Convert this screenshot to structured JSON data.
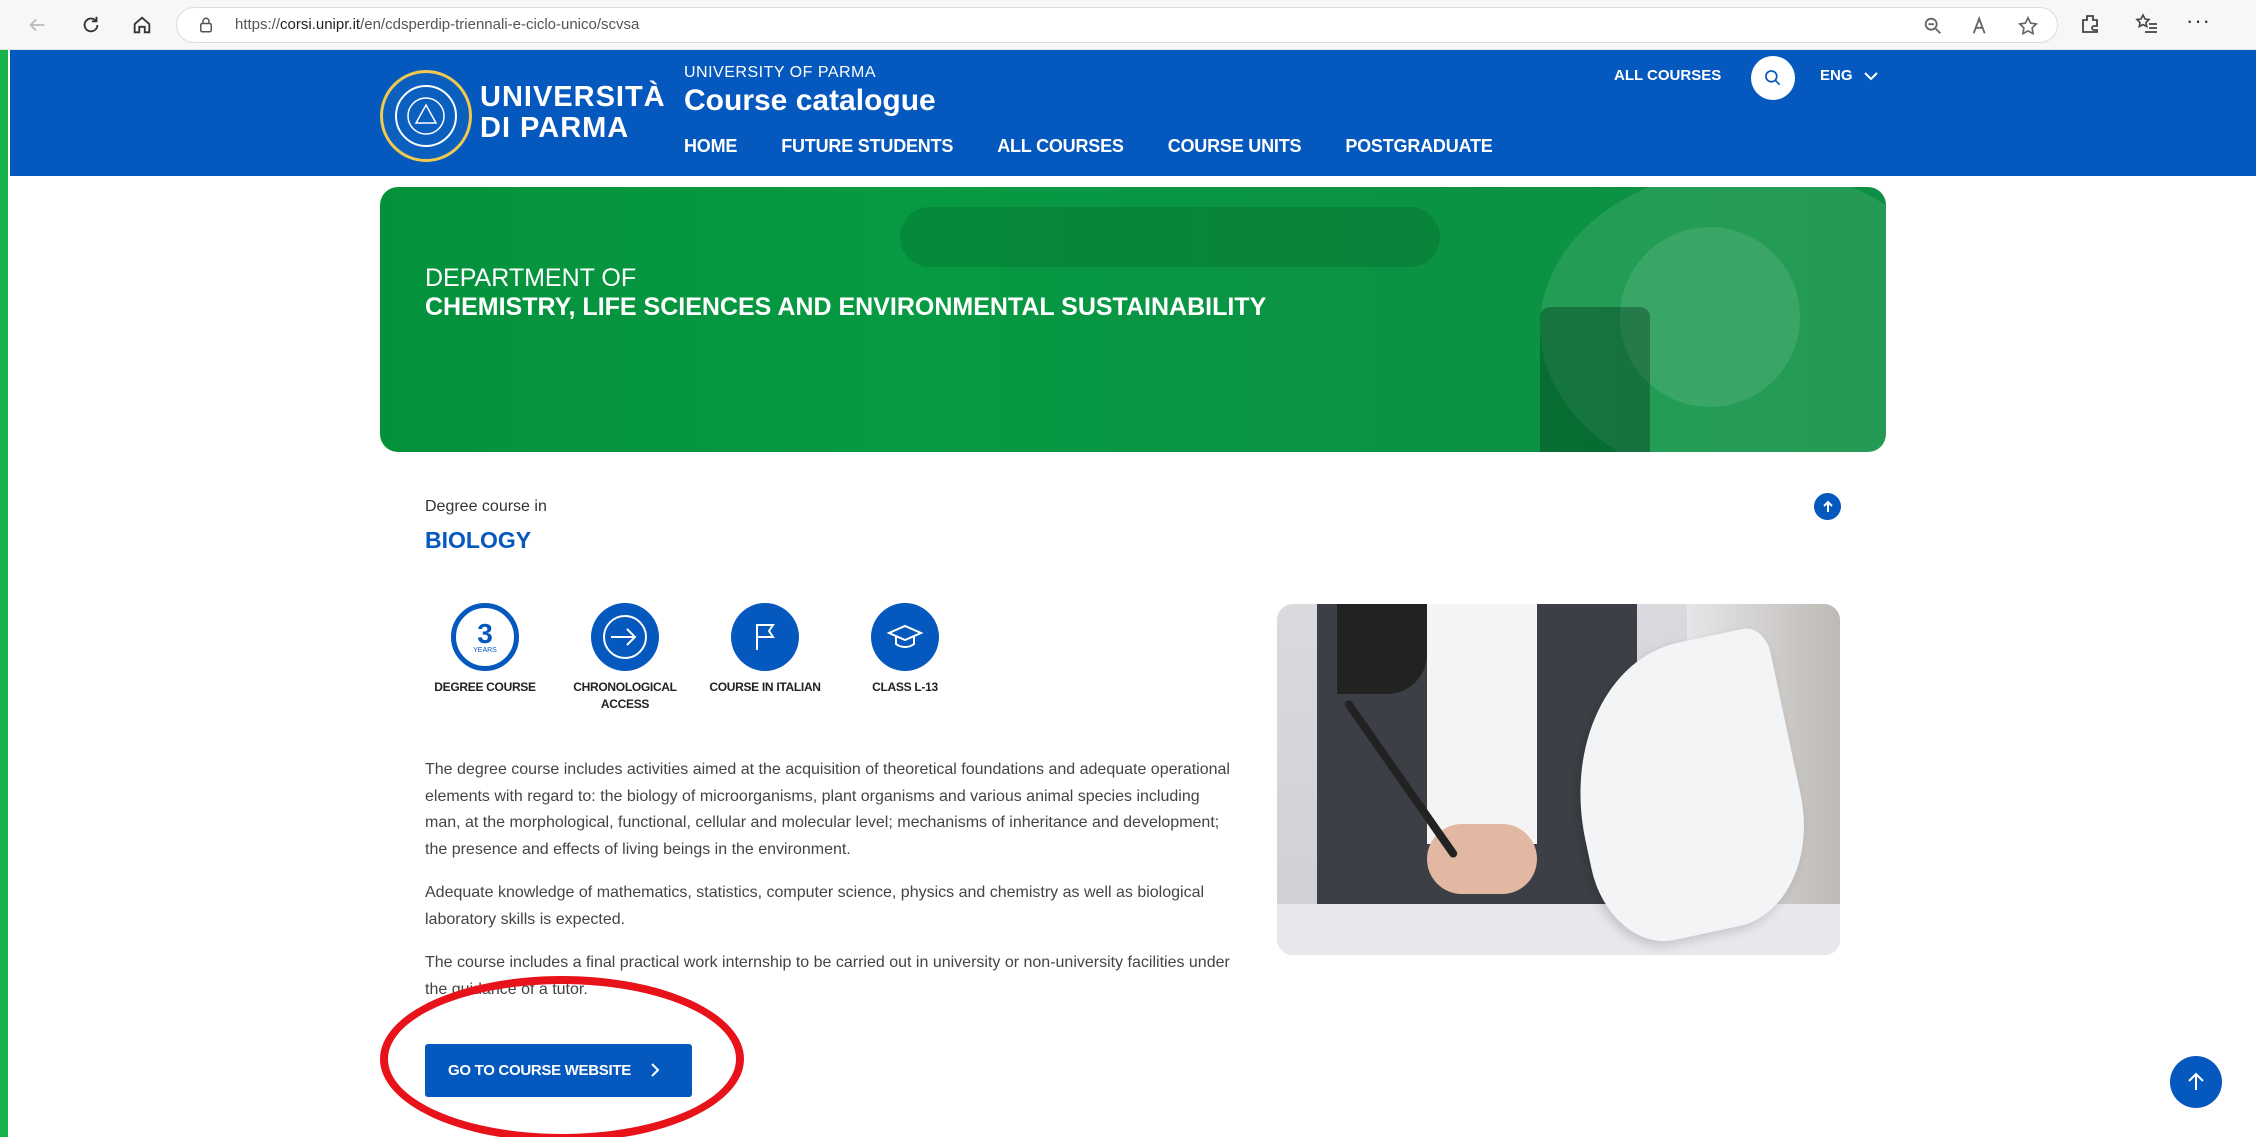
{
  "browser": {
    "url_prefix": "https://",
    "url_domain": "corsi.unipr.it",
    "url_path": "/en/cdsperdip-triennali-e-ciclo-unico/scvsa"
  },
  "header": {
    "logo_line1": "UNIVERSITÀ",
    "logo_line2": "DI PARMA",
    "overline": "UNIVERSITY OF PARMA",
    "title": "Course catalogue",
    "nav": [
      "HOME",
      "FUTURE STUDENTS",
      "ALL COURSES",
      "COURSE UNITS",
      "POSTGRADUATE"
    ],
    "all_courses": "ALL COURSES",
    "language": "ENG"
  },
  "banner": {
    "line1": "DEPARTMENT OF",
    "line2": "CHEMISTRY, LIFE SCIENCES AND ENVIRONMENTAL SUSTAINABILITY"
  },
  "course": {
    "label": "Degree course in",
    "title": "BIOLOGY",
    "features": [
      {
        "icon": "three-years-icon",
        "number": "3",
        "sub": "YEARS",
        "label": "DEGREE COURSE"
      },
      {
        "icon": "enter-arrow-icon",
        "label": "CHRONOLOGICAL ACCESS"
      },
      {
        "icon": "flag-icon",
        "label": "COURSE IN ITALIAN"
      },
      {
        "icon": "graduation-cap-icon",
        "label": "CLASS L-13"
      }
    ],
    "paragraphs": [
      "The degree course includes activities aimed at the acquisition of theoretical foundations and adequate operational elements with regard to: the biology of microorganisms, plant organisms and various animal species including man, at the morphological, functional, cellular and molecular level; mechanisms of inheritance and development; the presence and effects of living beings in the environment.",
      "Adequate knowledge of mathematics, statistics, computer science, physics and chemistry as well as biological laboratory skills is expected.",
      "The course includes a final practical work internship to be carried out in university or non-university facilities under the guidance of a tutor."
    ],
    "cta": "GO TO COURSE WEBSITE"
  },
  "colors": {
    "brand_blue": "#0558bd",
    "banner_green": "#079a42",
    "highlight_red": "#e8121a"
  }
}
